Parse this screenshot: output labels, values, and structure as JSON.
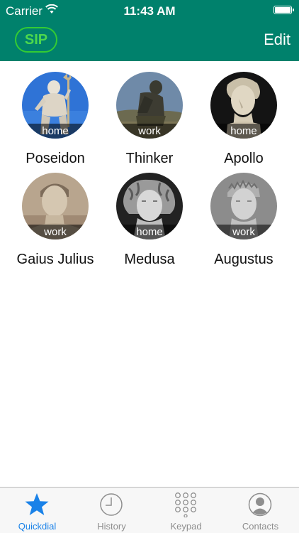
{
  "status_bar": {
    "carrier": "Carrier",
    "time": "11:43 AM"
  },
  "nav": {
    "sip_label": "SIP",
    "edit_label": "Edit"
  },
  "contacts": [
    {
      "name": "Poseidon",
      "tag": "home"
    },
    {
      "name": "Thinker",
      "tag": "work"
    },
    {
      "name": "Apollo",
      "tag": "home"
    },
    {
      "name": "Gaius Julius",
      "tag": "work"
    },
    {
      "name": "Medusa",
      "tag": "home"
    },
    {
      "name": "Augustus",
      "tag": "work"
    }
  ],
  "tabs": [
    {
      "label": "Quickdial",
      "icon": "star-icon",
      "active": true
    },
    {
      "label": "History",
      "icon": "clock-icon",
      "active": false
    },
    {
      "label": "Keypad",
      "icon": "keypad-icon",
      "active": false
    },
    {
      "label": "Contacts",
      "icon": "contact-icon",
      "active": false
    }
  ],
  "colors": {
    "nav_bar": "#00816c",
    "sip_accent": "#33cc33",
    "active_tab": "#1a82e8",
    "inactive_tab": "#8e8e8e"
  }
}
